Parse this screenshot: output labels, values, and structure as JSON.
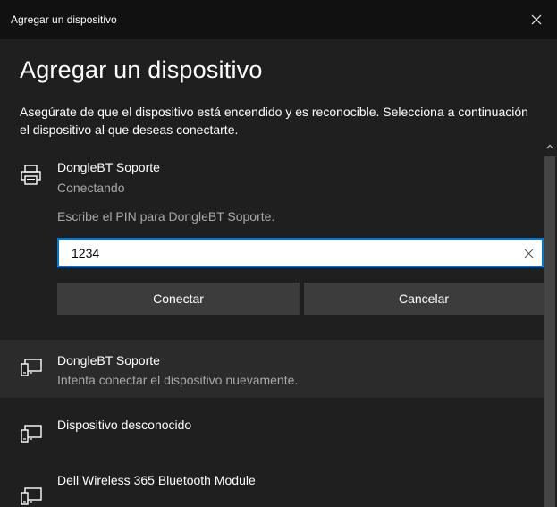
{
  "window": {
    "title": "Agregar un dispositivo",
    "close_icon": "close-icon"
  },
  "heading": "Agregar un dispositivo",
  "intro": "Asegúrate de que el dispositivo está encendido y es reconocible. Selecciona a continuación el dispositivo al que deseas conectarte.",
  "devices": [
    {
      "name": "DongleBT Soporte",
      "status": "Conectando",
      "icon": "printer-icon",
      "pin_prompt": "Escribe el PIN para DongleBT Soporte.",
      "pin_value": "1234",
      "connect_label": "Conectar",
      "cancel_label": "Cancelar"
    },
    {
      "name": "DongleBT Soporte",
      "status": "Intenta conectar el dispositivo nuevamente.",
      "icon": "device-icon"
    },
    {
      "name": "Dispositivo desconocido",
      "icon": "device-icon"
    },
    {
      "name": "Dell Wireless 365 Bluetooth Module",
      "icon": "device-icon"
    }
  ],
  "colors": {
    "background": "#1f1f1f",
    "titlebar": "#111111",
    "accent": "#0078d7",
    "button": "#3c3c3c",
    "selected_row": "#2b2b2b",
    "secondary_text": "#a8a8a8"
  }
}
